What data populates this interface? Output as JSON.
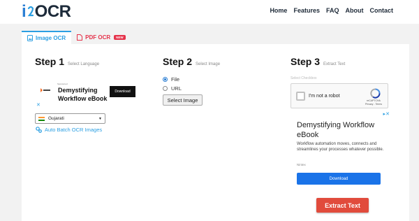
{
  "header": {
    "logo_text": "OCR",
    "nav": [
      "Home",
      "Features",
      "FAQ",
      "About",
      "Contact"
    ]
  },
  "tabs": [
    {
      "label": "Image OCR",
      "active": true
    },
    {
      "label": "PDF OCR",
      "badge": "NEW"
    }
  ],
  "step1": {
    "title": "Step 1",
    "subtitle": "Select Language"
  },
  "step2": {
    "title": "Step 2",
    "subtitle": "Select Image"
  },
  "step3": {
    "title": "Step 3",
    "subtitle": "Extract Text"
  },
  "ad1": {
    "fine_print": "Sponsored",
    "headline": "Demystifying Workflow eBook",
    "button": "Download"
  },
  "language": {
    "selected": "Gujarati"
  },
  "batch_link": "Auto Batch OCR Images",
  "source_options": [
    {
      "label": "File",
      "checked": true
    },
    {
      "label": "URL",
      "checked": false
    }
  ],
  "image_button": "Select Image",
  "captcha": {
    "label": "Select Checkbox",
    "text": "I'm not a robot",
    "brand": "reCAPTCHA",
    "links": "Privacy - Terms"
  },
  "ad2": {
    "headline": "Demystifying Workflow eBook",
    "body": "Workflow automation moves, connects and streamlines your processes whatever possible.",
    "brand": "Nintex",
    "button": "Download"
  },
  "extract_button": "Extract Text",
  "colors": {
    "accent_blue": "#2b9fe2",
    "extract_red": "#e14b3c",
    "pdf_red": "#e5334b"
  }
}
